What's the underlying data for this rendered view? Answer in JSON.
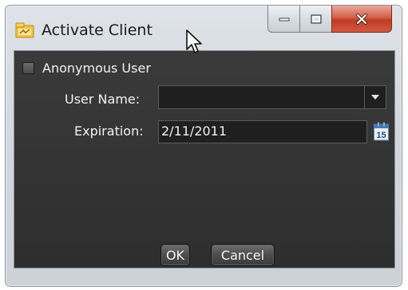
{
  "window": {
    "title": "Activate Client",
    "icon": "activate-client-icon"
  },
  "caption_buttons": {
    "minimize_icon": "minimize-icon",
    "maximize_icon": "maximize-icon",
    "close_icon": "close-icon"
  },
  "form": {
    "anonymous_label": "Anonymous User",
    "anonymous_checked": false,
    "username_label": "User Name:",
    "username_value": "",
    "expiration_label": "Expiration:",
    "expiration_value": "2/11/2011",
    "calendar_day": "15"
  },
  "buttons": {
    "ok_label": "OK",
    "cancel_label": "Cancel"
  },
  "colors": {
    "client_background": "#2e2e2e",
    "close_button": "#c23a22",
    "text": "#f2f2f2"
  }
}
